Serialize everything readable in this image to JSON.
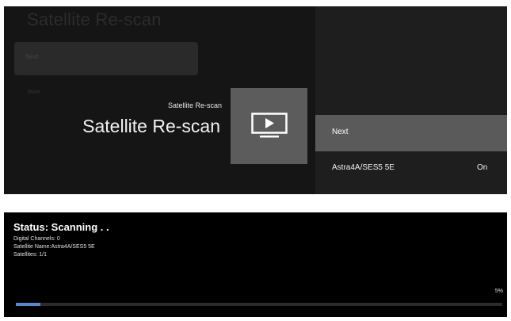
{
  "background": {
    "title": "Satellite Re-scan",
    "next_label": "Next",
    "more_label": "More"
  },
  "header": {
    "small_title": "Satellite Re-scan",
    "big_title": "Satellite Re-scan"
  },
  "menu": {
    "items": [
      {
        "label": "Next",
        "selected": true
      },
      {
        "label": "Astra4A/SES5 5E",
        "value": "On"
      }
    ]
  },
  "icon": "tv-play-icon",
  "status_panel": {
    "status": "Status: Scanning . .",
    "digital_channels": "Digital Channels:  0",
    "satellite_name": "Satellite Name:Astra4A/SES5 5E",
    "satellites": "Satellites:  1/1",
    "percent_label": "5%",
    "progress": 0.05
  },
  "colors": {
    "progress_fill": "#5b86c7",
    "selected_row": "#5a5a5a",
    "tile": "#5c5c5c"
  }
}
